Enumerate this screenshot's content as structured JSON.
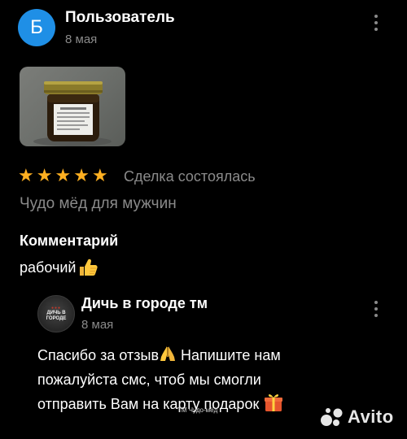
{
  "review": {
    "avatar_letter": "Б",
    "author": "Пользователь",
    "date": "8 мая",
    "rating": 5,
    "deal_status": "Сделка состоялась",
    "product": "Чудо мёд для мужчин",
    "comment_heading": "Комментарий",
    "comment_text": "рабочий",
    "comment_emoji": "thumbs-up-emoji"
  },
  "reply": {
    "seller_name": "Дичь в городе тм",
    "seller_logo_text": "ДИЧЬ В ГОРОДЕ",
    "date": "8 мая",
    "line1": "Спасибо за отзыв",
    "line1_rest": " Напишите нам",
    "line2": "пожалуйста смс, чтоб мы смогли",
    "line3": "отправить Вам на карту подарок",
    "emojis": [
      "folded-hands-emoji",
      "gift-emoji"
    ]
  },
  "watermark": {
    "overlay_text": "ТМ Чудо-мёд",
    "brand": "Avito"
  },
  "colors": {
    "background": "#000000",
    "avatar": "#1f8fe6",
    "star": "#ffb021",
    "muted_text": "#8a8a8a"
  }
}
